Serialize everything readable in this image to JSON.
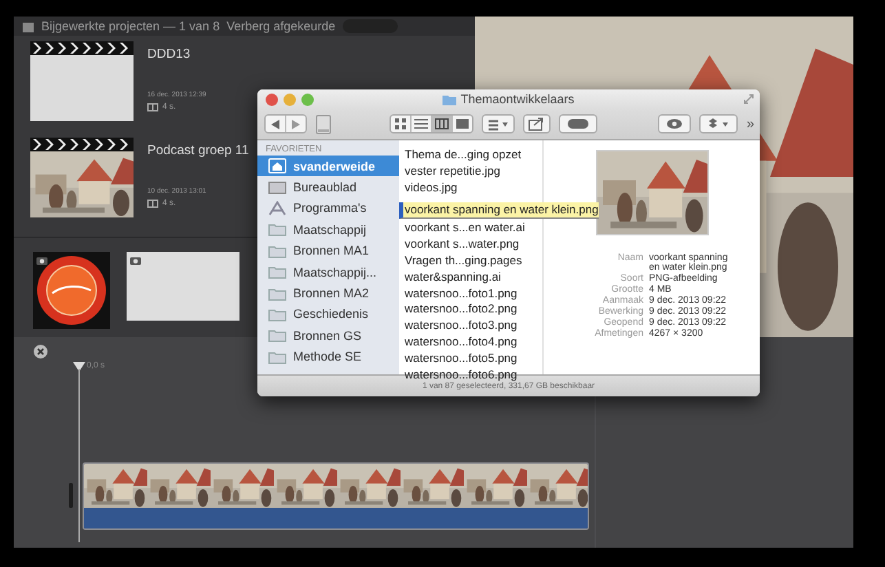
{
  "library": {
    "header": "Bijgewerkte projecten — 1 van 8",
    "filter": "Verberg afgekeurde"
  },
  "projects": [
    {
      "title": "DDD13",
      "date": "16 dec. 2013 12:39",
      "duration": "4 s.",
      "kind": "blank"
    },
    {
      "title": "Podcast groep 11",
      "date": "10 dec. 2013 13:01",
      "duration": "4 s.",
      "kind": "picture"
    }
  ],
  "events": [
    {
      "kind": "logo"
    },
    {
      "kind": "blank"
    }
  ],
  "timeline": {
    "playhead": "0,0 s"
  },
  "finder": {
    "title": "Themaontwikkelaars",
    "overflow": "»",
    "sidebar_heading": "FAVORIETEN",
    "sidebar_items": [
      {
        "label": "svanderweide",
        "kind": "home",
        "selected": true
      },
      {
        "label": "Bureaublad",
        "kind": "desktop",
        "selected": false
      },
      {
        "label": "Programma's",
        "kind": "apps",
        "selected": false
      },
      {
        "label": "Maatschappij",
        "kind": "folder",
        "selected": false
      },
      {
        "label": "Bronnen MA1",
        "kind": "folder",
        "selected": false
      },
      {
        "label": "Maatschappij...",
        "kind": "folder",
        "selected": false
      },
      {
        "label": "Bronnen MA2",
        "kind": "folder",
        "selected": false
      },
      {
        "label": "Geschiedenis",
        "kind": "folder",
        "selected": false
      },
      {
        "label": "Bronnen GS",
        "kind": "folder",
        "selected": false
      },
      {
        "label": "Methode SE",
        "kind": "folder",
        "selected": false
      }
    ],
    "files": [
      {
        "name": "Thema de...ging opzet",
        "selected": false
      },
      {
        "name": "vester repetitie.jpg",
        "selected": false
      },
      {
        "name": "videos.jpg",
        "selected": false
      },
      {
        "name": "voorkant spanning en water klein.png",
        "selected": true
      },
      {
        "name": "voorkant s...en water.ai",
        "selected": false
      },
      {
        "name": "voorkant s...water.png",
        "selected": false
      },
      {
        "name": "Vragen th...ging.pages",
        "selected": false
      },
      {
        "name": "water&spanning.ai",
        "selected": false
      },
      {
        "name": "watersnoo...foto1.png",
        "selected": false
      },
      {
        "name": "watersnoo...foto2.png",
        "selected": false
      },
      {
        "name": "watersnoo...foto3.png",
        "selected": false
      },
      {
        "name": "watersnoo...foto4.png",
        "selected": false
      },
      {
        "name": "watersnoo...foto5.png",
        "selected": false
      },
      {
        "name": "watersnoo...foto6.png",
        "selected": false
      }
    ],
    "info": [
      {
        "label": "Naam",
        "value": "voorkant spanning en water klein.png"
      },
      {
        "label": "Soort",
        "value": "PNG-afbeelding"
      },
      {
        "label": "Grootte",
        "value": "4 MB"
      },
      {
        "label": "Aanmaak",
        "value": "9 dec. 2013 09:22"
      },
      {
        "label": "Bewerking",
        "value": "9 dec. 2013 09:22"
      },
      {
        "label": "Geopend",
        "value": "9 dec. 2013 09:22"
      },
      {
        "label": "Afmetingen",
        "value": "4267 × 3200"
      }
    ],
    "status": "1 van 87 geselecteerd, 331,67 GB beschikbaar"
  }
}
